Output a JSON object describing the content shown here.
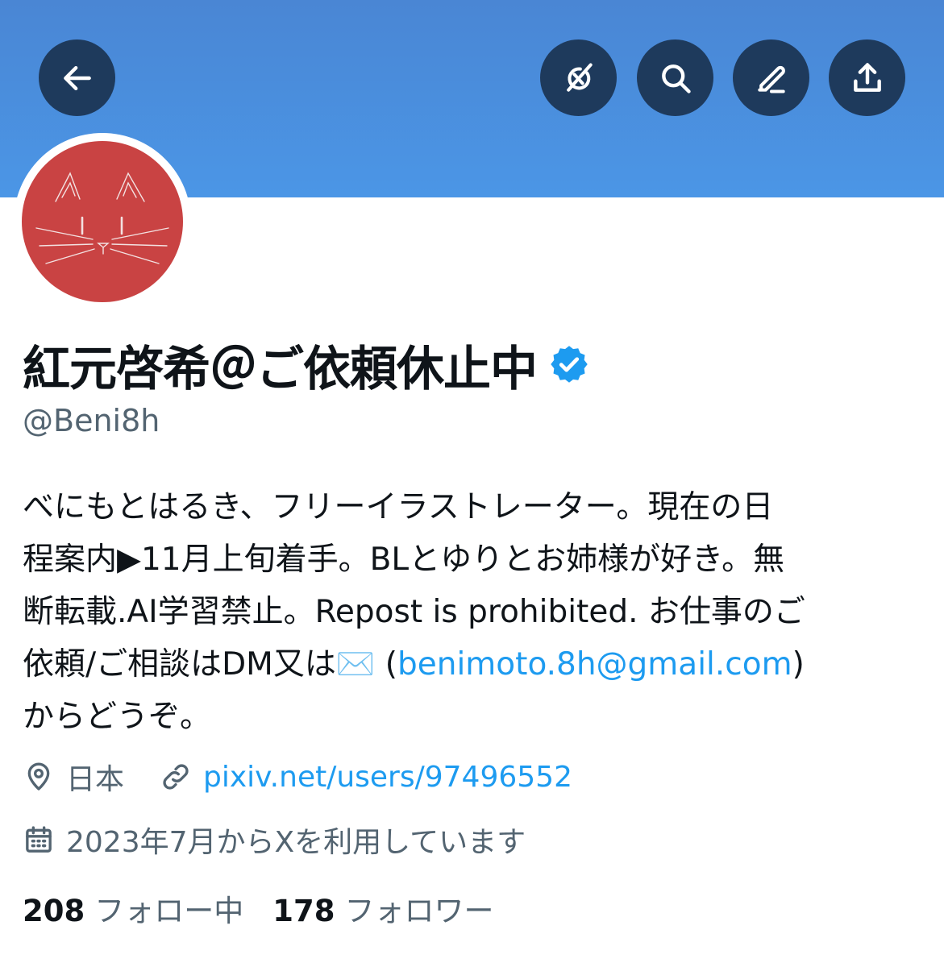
{
  "header": {
    "banner_color": "#4b8fe0",
    "buttons": [
      {
        "name": "back",
        "icon": "arrow-left-icon"
      },
      {
        "name": "grok",
        "icon": "grok-icon"
      },
      {
        "name": "search",
        "icon": "search-icon"
      },
      {
        "name": "edit",
        "icon": "edit-icon"
      },
      {
        "name": "share",
        "icon": "share-icon"
      }
    ]
  },
  "profile": {
    "avatar_color": "#c94343",
    "display_name": "紅元啓希＠ご依頼休止中",
    "verified": true,
    "handle": "@Beni8h",
    "bio_lines": [
      "べにもとはるき、フリーイラストレーター。現在の日",
      "程案内▶11月上旬着手。BLとゆりとお姉様が好き。無",
      "断転載.AI学習禁止。Repost is prohibited. お仕事のご"
    ],
    "bio_line4_text": "依頼/ご相談はDM又は✉️ (",
    "bio_email": "benimoto.8h@gmail.com",
    "bio_line4_end": ")",
    "bio_line5": "からどうぞ。",
    "location": "日本",
    "website": "pixiv.net/users/97496552",
    "joined": "2023年7月からXを利用しています",
    "following_count": "208",
    "following_label": "フォロー中",
    "followers_count": "178",
    "followers_label": "フォロワー"
  }
}
